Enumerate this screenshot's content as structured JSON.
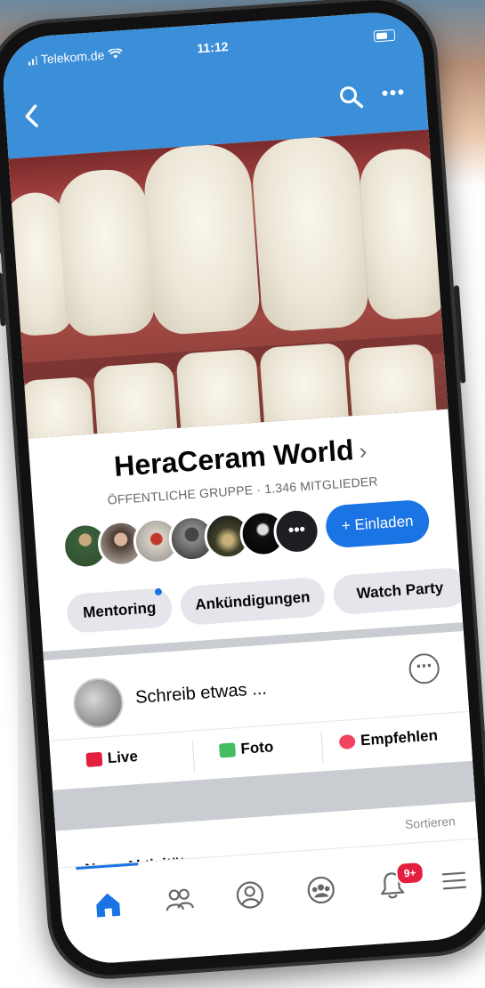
{
  "status_bar": {
    "carrier": "Telekom.de",
    "time": "11:12"
  },
  "nav": {
    "back_icon": "chevron-left-icon",
    "search_icon": "search-icon",
    "more_icon": "ellipsis-icon"
  },
  "group": {
    "name": "HeraCeram World",
    "name_chevron": "›",
    "meta": "ÖFFENTLICHE GRUPPE · 1.346 MITGLIEDER",
    "invite_label": "+ Einladen"
  },
  "chips": [
    {
      "label": "Mentoring"
    },
    {
      "label": "Ankündigungen"
    },
    {
      "label": "Watch Party"
    }
  ],
  "composer": {
    "placeholder": "Schreib etwas ..."
  },
  "actions": [
    {
      "label": "Live",
      "icon": "live-icon",
      "color": "#e41e3f"
    },
    {
      "label": "Foto",
      "icon": "photo-icon",
      "color": "#45bd62"
    },
    {
      "label": "Empfehlen",
      "icon": "recommend-icon",
      "color": "#f3425f"
    }
  ],
  "feed": {
    "sort_label": "Sortieren",
    "title": "Neue Aktivität"
  },
  "tabbar": {
    "notification_count": "9+"
  },
  "colors": {
    "header": "#3b8ed8",
    "accent": "#1b74e4",
    "badge": "#e41e3f"
  }
}
